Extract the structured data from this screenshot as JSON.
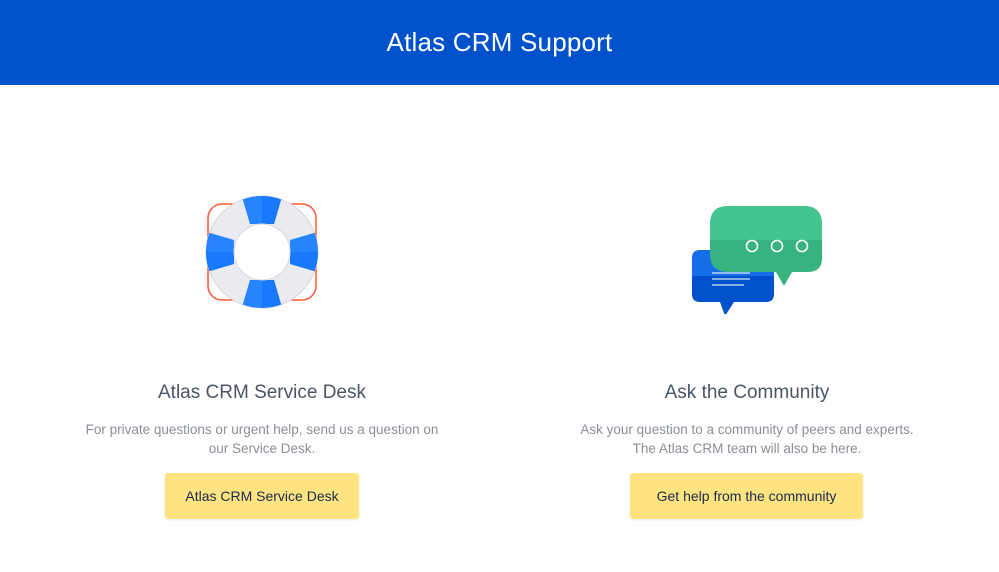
{
  "header": {
    "title": "Atlas CRM Support"
  },
  "cards": [
    {
      "icon": "lifebuoy-icon",
      "title": "Atlas CRM Service Desk",
      "description_line1": "For private questions or urgent help, send us a question on",
      "description_line2": "our Service Desk.",
      "button_label": "Atlas CRM Service Desk"
    },
    {
      "icon": "chat-bubbles-icon",
      "title": "Ask the Community",
      "description_line1": "Ask your question to a community of peers and experts.",
      "description_line2": "The Atlas CRM team will also be here.",
      "button_label": "Get help from the community"
    }
  ],
  "colors": {
    "header_bg": "#0052cc",
    "button_bg": "#ffe380",
    "icon_blue": "#2684ff",
    "icon_green": "#36b37e",
    "lifebuoy_outline": "#ff5630"
  }
}
